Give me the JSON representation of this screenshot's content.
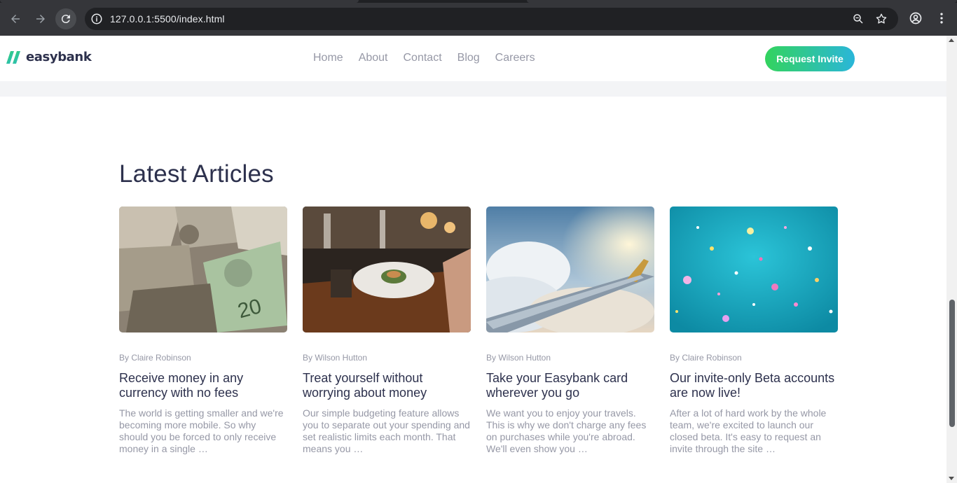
{
  "browser": {
    "url": "127.0.0.1:5500/index.html"
  },
  "site": {
    "logo_text": "easybank",
    "nav": [
      "Home",
      "About",
      "Contact",
      "Blog",
      "Careers"
    ],
    "cta_label": "Request Invite",
    "colors": {
      "primary": "#2d314d",
      "green": "#33d35e",
      "cyan": "#2ab6d9",
      "muted": "#9698a6"
    }
  },
  "articles": {
    "heading": "Latest Articles",
    "items": [
      {
        "author": "By Claire Robinson",
        "title": "Receive money in any currency with no fees",
        "excerpt": "The world is getting smaller and we're becoming more mobile. So why should you be forced to only receive money in a single …",
        "image": "currency-photo"
      },
      {
        "author": "By Wilson Hutton",
        "title": "Treat yourself without worrying about money",
        "excerpt": "Our simple budgeting feature allows you to separate out your spending and set realistic limits each month. That means you …",
        "image": "restaurant-photo"
      },
      {
        "author": "By Wilson Hutton",
        "title": "Take your Easybank card wherever you go",
        "excerpt": "We want you to enjoy your travels. This is why we don't charge any fees on purchases while you're abroad. We'll even show you …",
        "image": "plane-photo"
      },
      {
        "author": "By Claire Robinson",
        "title": "Our invite-only Beta accounts are now live!",
        "excerpt": "After a lot of hard work by the whole team, we're excited to launch our closed beta. It's easy to request an invite through the site …",
        "image": "confetti-photo"
      }
    ]
  }
}
